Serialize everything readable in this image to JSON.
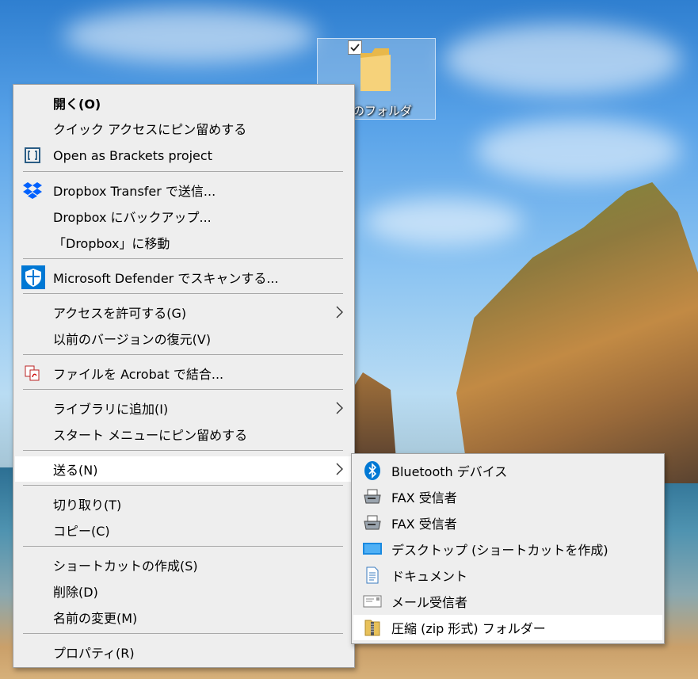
{
  "desktop": {
    "folder_label": "意のフォルダ"
  },
  "context_menu": {
    "items": [
      {
        "label": "開く(O)"
      },
      {
        "label": "クイック アクセスにピン留めする"
      },
      {
        "label": "Open as Brackets project",
        "icon": "brackets-icon"
      },
      {
        "label": "Dropbox Transfer で送信...",
        "icon": "dropbox-icon"
      },
      {
        "label": "Dropbox にバックアップ..."
      },
      {
        "label": "「Dropbox」に移動"
      },
      {
        "label": "Microsoft Defender でスキャンする...",
        "icon": "defender-shield-icon"
      },
      {
        "label": "アクセスを許可する(G)"
      },
      {
        "label": "以前のバージョンの復元(V)"
      },
      {
        "label": "ファイルを Acrobat で結合...",
        "icon": "acrobat-icon"
      },
      {
        "label": "ライブラリに追加(I)"
      },
      {
        "label": "スタート メニューにピン留めする"
      },
      {
        "label": "送る(N)"
      },
      {
        "label": "切り取り(T)"
      },
      {
        "label": "コピー(C)"
      },
      {
        "label": "ショートカットの作成(S)"
      },
      {
        "label": "削除(D)"
      },
      {
        "label": "名前の変更(M)"
      },
      {
        "label": "プロパティ(R)"
      }
    ]
  },
  "send_to_menu": {
    "items": [
      {
        "label": "Bluetooth デバイス",
        "icon": "bluetooth-icon"
      },
      {
        "label": "FAX 受信者",
        "icon": "fax-icon"
      },
      {
        "label": "FAX 受信者",
        "icon": "fax-icon"
      },
      {
        "label": "デスクトップ (ショートカットを作成)",
        "icon": "desktop-icon"
      },
      {
        "label": "ドキュメント",
        "icon": "documents-icon"
      },
      {
        "label": "メール受信者",
        "icon": "mail-icon"
      },
      {
        "label": "圧縮 (zip 形式) フォルダー",
        "icon": "zip-folder-icon"
      }
    ]
  },
  "colors": {
    "menu_bg": "#eeeeee",
    "highlight": "#ffffff",
    "dropbox": "#0061fe",
    "defender": "#0078d4",
    "bluetooth": "#0078d4"
  }
}
